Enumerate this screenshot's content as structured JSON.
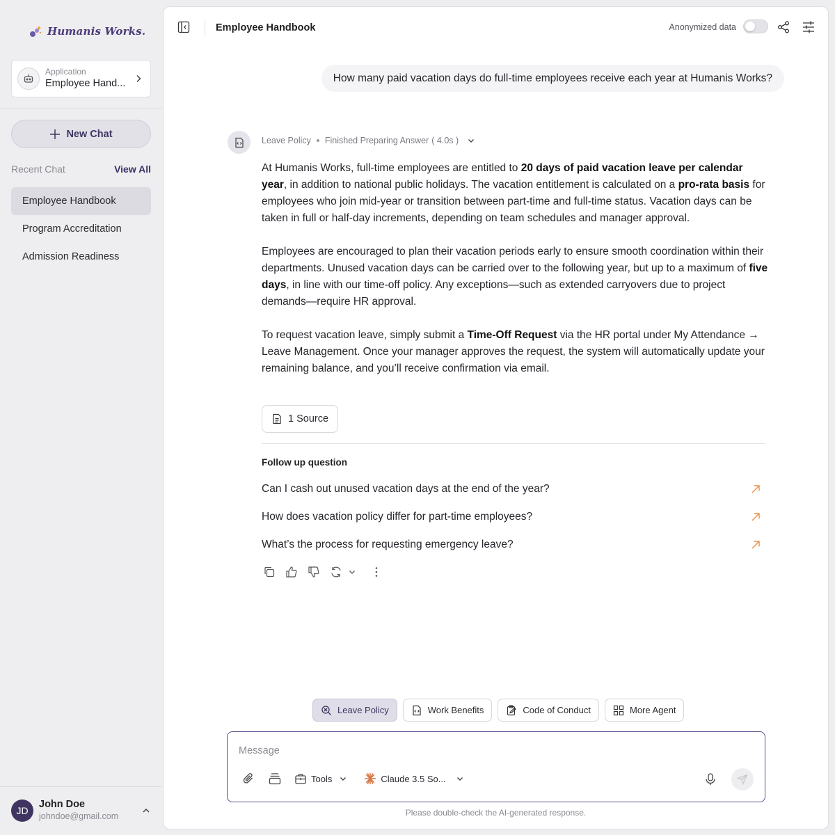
{
  "brand": {
    "name": "Humanis Works."
  },
  "app_card": {
    "label": "Application",
    "name": "Employee Hand..."
  },
  "sidebar": {
    "new_chat": "New Chat",
    "recent_title": "Recent Chat",
    "view_all": "View All",
    "chats": [
      {
        "label": "Employee Handbook",
        "active": true
      },
      {
        "label": "Program Accreditation",
        "active": false
      },
      {
        "label": "Admission Readiness",
        "active": false
      }
    ]
  },
  "user": {
    "initials": "JD",
    "name": "John Doe",
    "email": "johndoe@gmail.com"
  },
  "header": {
    "title": "Employee Handbook",
    "anonymized_label": "Anonymized data",
    "anonymized_on": false
  },
  "conversation": {
    "question": "How many paid vacation days do full-time employees receive each year at Humanis Works?",
    "meta": {
      "agent": "Leave Policy",
      "status": "Finished Preparing Answer",
      "duration": "( 4.0s )"
    },
    "paragraphs": [
      [
        {
          "t": "At Humanis Works, full-time employees are entitled to "
        },
        {
          "t": "20 days of paid vacation leave per calendar year",
          "b": true
        },
        {
          "t": ", in addition to national public holidays. The vacation entitlement is calculated on a "
        },
        {
          "t": "pro-rata basis",
          "b": true
        },
        {
          "t": " for employees who join mid-year or transition between part-time and full-time status. Vacation days can be taken in full or half-day increments, depending on team schedules and manager approval."
        }
      ],
      [
        {
          "t": "Employees are encouraged to plan their vacation periods early to ensure smooth coordination within their departments. Unused vacation days can be carried over to the following year, but up to a maximum of "
        },
        {
          "t": "five days",
          "b": true
        },
        {
          "t": ", in line with our time-off policy. Any exceptions—such as extended carryovers due to project demands—require HR approval."
        }
      ],
      [
        {
          "t": "To request vacation leave, simply submit a "
        },
        {
          "t": "Time-Off Request",
          "b": true
        },
        {
          "t": " via the HR portal under My Attendance → Leave Management. Once your manager approves the request, the system will automatically update your remaining balance, and you’ll receive confirmation via email."
        }
      ]
    ],
    "source_label": "1 Source",
    "followup_title": "Follow up question",
    "followups": [
      "Can I cash out unused vacation days at the end of the year?",
      "How does vacation policy differ for part-time employees?",
      "What’s the process for requesting emergency leave?"
    ]
  },
  "agents": [
    {
      "label": "Leave Policy",
      "icon": "search-doc-icon",
      "active": true
    },
    {
      "label": "Work Benefits",
      "icon": "doc-code-icon",
      "active": false
    },
    {
      "label": "Code of Conduct",
      "icon": "clipboard-edit-icon",
      "active": false
    },
    {
      "label": "More Agent",
      "icon": "grid-icon",
      "active": false
    }
  ],
  "composer": {
    "placeholder": "Message",
    "tools_label": "Tools",
    "model_label": "Claude 3.5 So...",
    "disclaimer": "Please double-check the AI-generated response."
  },
  "colors": {
    "accent": "#3f3560",
    "followup_arrow": "#e8904a",
    "model_icon": "#d97745"
  }
}
